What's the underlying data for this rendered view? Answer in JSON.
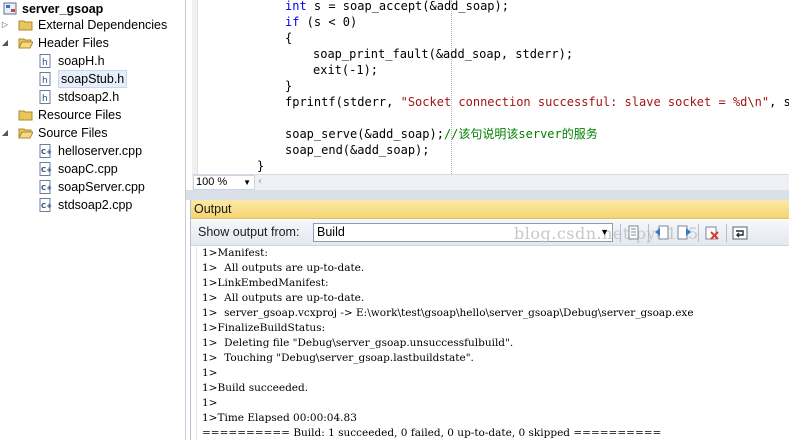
{
  "solution_explorer": {
    "project": "server_gsoap",
    "items": [
      {
        "label": "External Dependencies",
        "icon": "folder-icon",
        "expander": "collapsed"
      },
      {
        "label": "Header Files",
        "icon": "folder-open-icon",
        "expander": "expanded"
      },
      {
        "label": "soapH.h",
        "icon": "header-file-icon"
      },
      {
        "label": "soapStub.h",
        "icon": "header-file-icon",
        "selected": true
      },
      {
        "label": "stdsoap2.h",
        "icon": "header-file-icon"
      },
      {
        "label": "Resource Files",
        "icon": "folder-icon"
      },
      {
        "label": "Source Files",
        "icon": "folder-open-icon",
        "expander": "expanded"
      },
      {
        "label": "helloserver.cpp",
        "icon": "cpp-file-icon"
      },
      {
        "label": "soapC.cpp",
        "icon": "cpp-file-icon"
      },
      {
        "label": "soapServer.cpp",
        "icon": "cpp-file-icon"
      },
      {
        "label": "stdsoap2.cpp",
        "icon": "cpp-file-icon"
      }
    ]
  },
  "editor": {
    "lines": [
      {
        "segments": [
          {
            "t": "int",
            "c": "kw"
          },
          {
            "t": " s = soap_accept(&add_soap);",
            "c": ""
          }
        ]
      },
      {
        "segments": [
          {
            "t": "if",
            "c": "kw"
          },
          {
            "t": " (s < 0)",
            "c": ""
          }
        ]
      },
      {
        "segments": [
          {
            "t": "{",
            "c": ""
          }
        ]
      },
      {
        "segments": [
          {
            "t": "soap_print_fault(&add_soap, stderr);",
            "c": ""
          }
        ]
      },
      {
        "segments": [
          {
            "t": "exit(-1);",
            "c": ""
          }
        ]
      },
      {
        "segments": [
          {
            "t": "}",
            "c": ""
          }
        ]
      },
      {
        "segments": [
          {
            "t": "fprintf(stderr, ",
            "c": ""
          },
          {
            "t": "\"Socket connection successful: slave socket = %d\\n\"",
            "c": "str"
          },
          {
            "t": ", s);",
            "c": ""
          }
        ]
      },
      {
        "segments": []
      },
      {
        "segments": [
          {
            "t": "soap_serve(&add_soap);",
            "c": ""
          },
          {
            "t": "//该句说明该server的服务",
            "c": "cmt"
          }
        ]
      },
      {
        "segments": [
          {
            "t": "soap_end(&add_soap);",
            "c": ""
          }
        ]
      },
      {
        "segments": [
          {
            "t": "}",
            "c": ""
          }
        ]
      }
    ],
    "zoom": "100 %"
  },
  "output": {
    "title": "Output",
    "show_from_label": "Show output from:",
    "source_value": "Build",
    "watermark": "blog.csdn.net/py8105",
    "lines": [
      "1>Manifest:",
      "1>  All outputs are up-to-date.",
      "1>LinkEmbedManifest:",
      "1>  All outputs are up-to-date.",
      "1>  server_gsoap.vcxproj -> E:\\work\\test\\gsoap\\hello\\server_gsoap\\Debug\\server_gsoap.exe",
      "1>FinalizeBuildStatus:",
      "1>  Deleting file \"Debug\\server_gsoap.unsuccessfulbuild\".",
      "1>  Touching \"Debug\\server_gsoap.lastbuildstate\".",
      "1>",
      "1>Build succeeded.",
      "1>",
      "1>Time Elapsed 00:00:04.83",
      "========== Build: 1 succeeded, 0 failed, 0 up-to-date, 0 skipped =========="
    ]
  }
}
